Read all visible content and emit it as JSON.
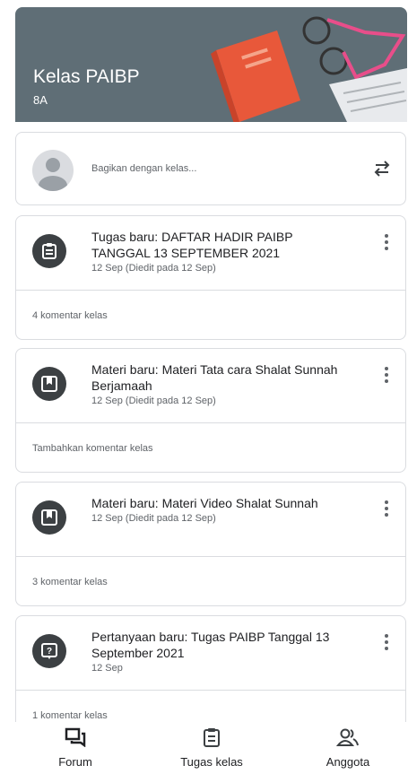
{
  "header": {
    "class_name": "Kelas PAIBP",
    "section": "8A",
    "accent": "#5f6e76"
  },
  "share": {
    "placeholder": "Bagikan dengan kelas..."
  },
  "posts": [
    {
      "icon": "assignment-icon",
      "title": "Tugas baru: DAFTAR HADIR PAIBP TANGGAL 13 SEPTEMBER 2021",
      "date": "12 Sep (Diedit pada 12 Sep)",
      "comment": "4 komentar kelas"
    },
    {
      "icon": "material-icon",
      "title": "Materi baru: Materi Tata cara Shalat Sunnah Berjamaah",
      "date": "12 Sep (Diedit pada 12 Sep)",
      "comment": "Tambahkan komentar kelas"
    },
    {
      "icon": "material-icon",
      "title": "Materi baru: Materi Video Shalat Sunnah",
      "date": "12 Sep (Diedit pada 12 Sep)",
      "comment": "3 komentar kelas"
    },
    {
      "icon": "question-icon",
      "title": "Pertanyaan baru: Tugas PAIBP Tanggal 13 September 2021",
      "date": "12 Sep",
      "comment": "1 komentar kelas"
    }
  ],
  "nav": {
    "forum": "Forum",
    "classwork": "Tugas kelas",
    "people": "Anggota"
  }
}
